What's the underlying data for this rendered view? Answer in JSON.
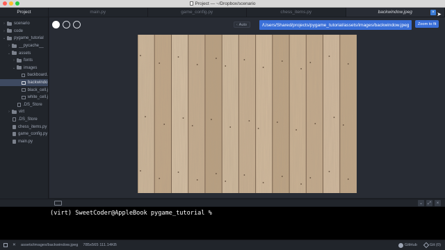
{
  "window": {
    "title": "Project — ~/Dropbox/scenario"
  },
  "tabs": {
    "project": "Project",
    "files": [
      {
        "label": "main.py",
        "active": false
      },
      {
        "label": "game_config.py",
        "active": false
      },
      {
        "label": "chess_items.py",
        "active": false
      },
      {
        "label": "backwindow.jpeg",
        "active": true
      }
    ],
    "close_glyph": "×"
  },
  "sidebar": {
    "items": [
      {
        "label": "scenario",
        "type": "folder",
        "depth": 0,
        "chev": "›"
      },
      {
        "label": "code",
        "type": "folder",
        "depth": 0,
        "chev": "›"
      },
      {
        "label": "pygame_tutorial",
        "type": "folder",
        "depth": 0,
        "chev": "⌄"
      },
      {
        "label": "__pycache__",
        "type": "folder",
        "depth": 1,
        "chev": "›"
      },
      {
        "label": "assets",
        "type": "folder",
        "depth": 1,
        "chev": "⌄"
      },
      {
        "label": "fonts",
        "type": "folder",
        "depth": 2,
        "chev": "›"
      },
      {
        "label": "images",
        "type": "folder",
        "depth": 2,
        "chev": "⌄"
      },
      {
        "label": "backboard.",
        "type": "image",
        "depth": 3
      },
      {
        "label": "backwindo",
        "type": "image",
        "depth": 3,
        "selected": true
      },
      {
        "label": "black_cell.j",
        "type": "image",
        "depth": 3
      },
      {
        "label": "white_cell.j",
        "type": "image",
        "depth": 3
      },
      {
        "label": ".DS_Store",
        "type": "file",
        "depth": 2
      },
      {
        "label": "virt",
        "type": "folder",
        "depth": 1,
        "chev": "›"
      },
      {
        "label": ".DS_Store",
        "type": "file",
        "depth": 1
      },
      {
        "label": "chess_items.py",
        "type": "py",
        "depth": 1
      },
      {
        "label": "game_config.py",
        "type": "py",
        "depth": 1
      },
      {
        "label": "main.py",
        "type": "py",
        "depth": 1
      }
    ]
  },
  "image_view": {
    "auto_label": "Auto",
    "auto_chevron": "‹",
    "path_tooltip": "/Users/Shared/projects/pygame_tutorial/assets/images/backwindow.jpeg",
    "zoom_label": "Zoom to fit",
    "background_options": [
      "white",
      "black",
      "transparent"
    ]
  },
  "terminal": {
    "prompt": "(virt) SweetCoder@AppleBook pygame_tutorial % ",
    "controls": [
      "⌄",
      "⤢",
      "×"
    ]
  },
  "statusbar": {
    "path": "assets/images/backwindow.jpeg",
    "dims": "785x565 111.14KB",
    "github": "GitHub",
    "git": "Git (0)"
  },
  "colors": {
    "accent": "#3a6fd8",
    "selection": "#3e4a61",
    "wood": "#c7b195"
  }
}
